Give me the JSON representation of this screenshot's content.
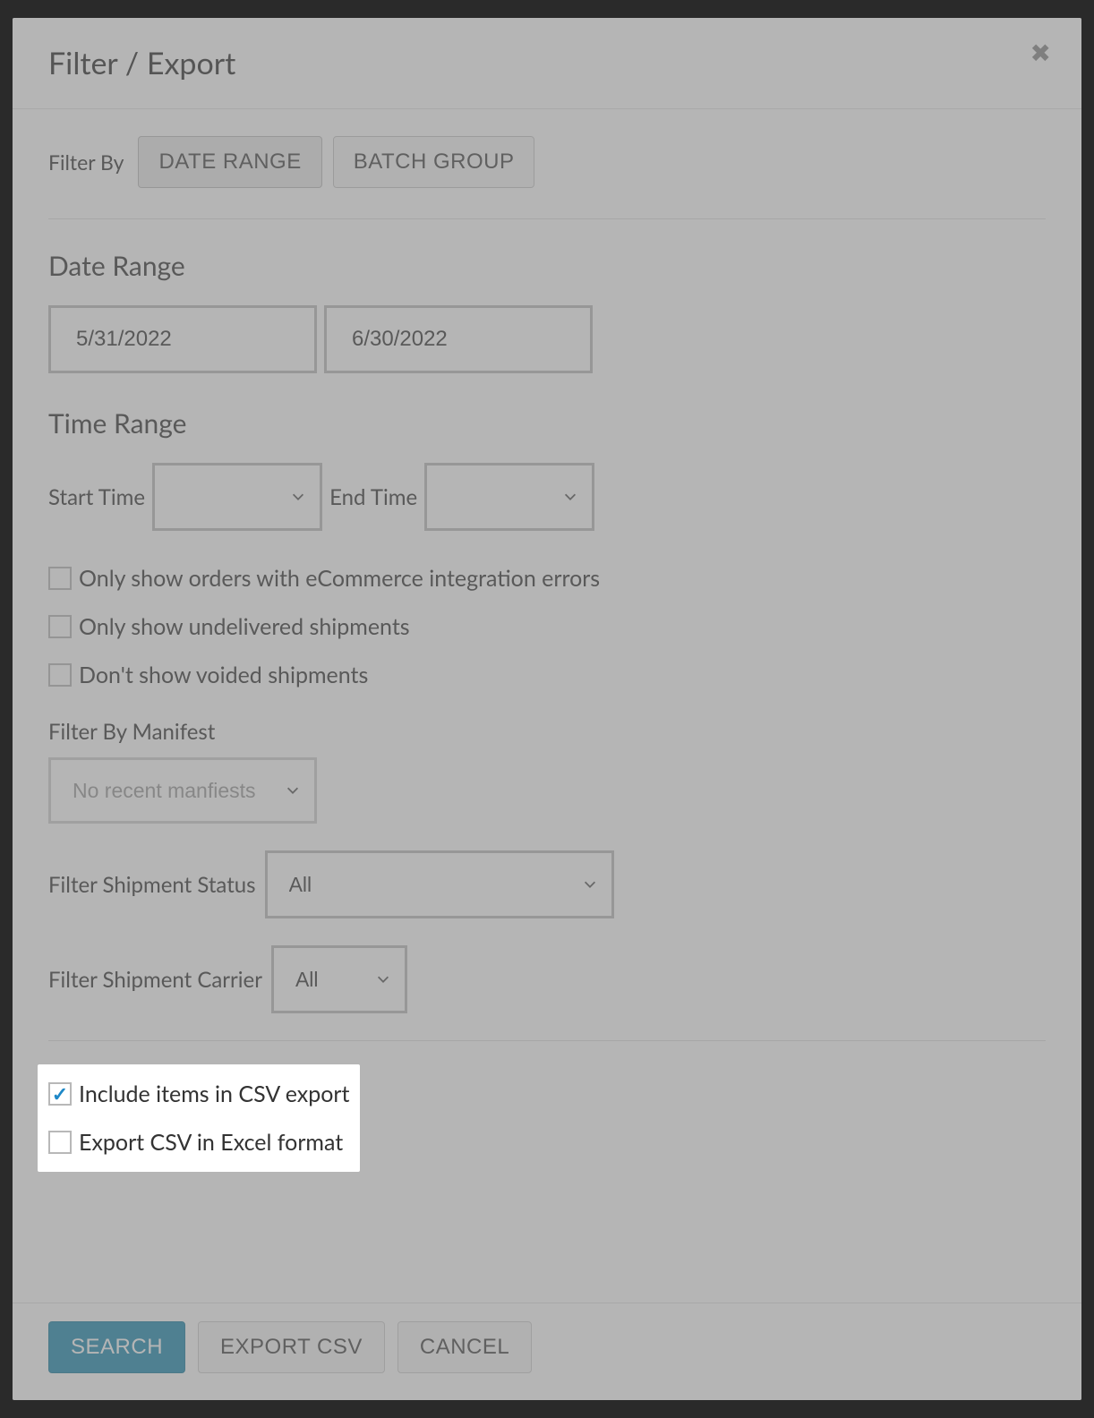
{
  "modal": {
    "title": "Filter / Export",
    "filterByLabel": "Filter By",
    "tabs": {
      "dateRange": "DATE RANGE",
      "batchGroup": "BATCH GROUP"
    },
    "dateRange": {
      "heading": "Date Range",
      "start": "5/31/2022",
      "end": "6/30/2022"
    },
    "timeRange": {
      "heading": "Time Range",
      "startLabel": "Start Time",
      "endLabel": "End Time",
      "startValue": "",
      "endValue": ""
    },
    "checkboxes": {
      "ecommerceErrors": "Only show orders with eCommerce integration errors",
      "undelivered": "Only show undelivered shipments",
      "voided": "Don't show voided shipments",
      "includeItems": "Include items in CSV export",
      "excelFormat": "Export CSV in Excel format"
    },
    "filterManifest": {
      "label": "Filter By Manifest",
      "placeholder": "No recent manfiests"
    },
    "filterStatus": {
      "label": "Filter Shipment Status",
      "value": "All"
    },
    "filterCarrier": {
      "label": "Filter Shipment Carrier",
      "value": "All"
    },
    "buttons": {
      "search": "SEARCH",
      "exportCsv": "EXPORT CSV",
      "cancel": "CANCEL"
    }
  }
}
